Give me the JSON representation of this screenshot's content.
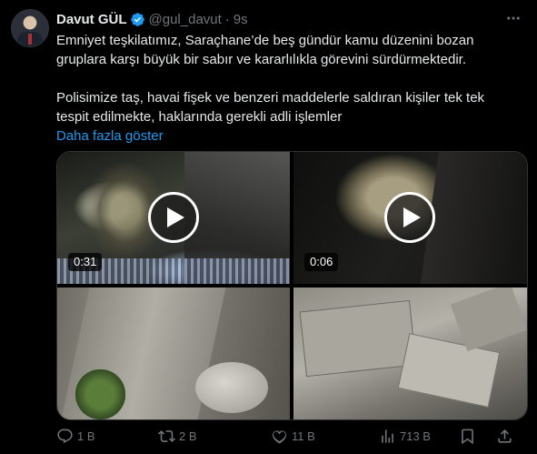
{
  "author": {
    "name": "Davut GÜL",
    "handle": "@gul_davut",
    "separator": "·",
    "time": "9s",
    "verified_color": "#1d9bf0"
  },
  "tweet": {
    "paragraph1": "Emniyet teşkilatımız, Saraçhane’de beş gündür kamu düzenini bozan gruplara karşı büyük bir sabır ve kararlılıkla görevini sürdürmektedir.",
    "paragraph2": "Polisimize taş, havai fişek ve benzeri maddelerle saldıran kişiler tek tek tespit edilmekte, haklarında gerekli adli işlemler",
    "show_more": "Daha fazla göster"
  },
  "media": {
    "video1_duration": "0:31",
    "video2_duration": "0:06"
  },
  "actions": {
    "replies": "1 B",
    "retweets": "2 B",
    "likes": "11 B",
    "views": "713 B"
  },
  "colors": {
    "background": "#000000",
    "text": "#e7e9ea",
    "muted": "#71767b",
    "link": "#1d9bf0"
  },
  "icons": [
    "more-icon",
    "verified-icon",
    "play-icon",
    "reply-icon",
    "retweet-icon",
    "like-icon",
    "views-icon",
    "bookmark-icon",
    "share-icon"
  ]
}
